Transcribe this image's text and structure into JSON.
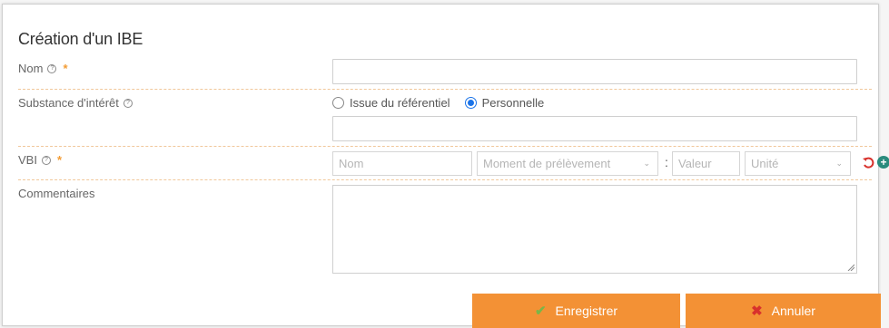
{
  "dialog": {
    "title": "Création d'un IBE"
  },
  "fields": {
    "nom": {
      "label": "Nom",
      "required_mark": "*",
      "value": ""
    },
    "substance": {
      "label": "Substance d'intérêt",
      "options": [
        "Issue du référentiel",
        "Personnelle"
      ],
      "selected": "Personnelle",
      "value": ""
    },
    "vbi": {
      "label": "VBI",
      "required_mark": "*",
      "nom_placeholder": "Nom",
      "moment_placeholder": "Moment de prélèvement",
      "colon": ":",
      "valeur_placeholder": "Valeur",
      "unite_placeholder": "Unité"
    },
    "commentaires": {
      "label": "Commentaires",
      "value": ""
    }
  },
  "icons": {
    "help": "?",
    "chevron": "⌄",
    "add": "+",
    "check": "✔",
    "close": "✖"
  },
  "buttons": {
    "save_label": "Enregistrer",
    "cancel_label": "Annuler"
  },
  "colors": {
    "accent": "#f39135",
    "required": "#f39c34",
    "radio_selected": "#1a73e8",
    "undo": "#d8312c",
    "add": "#2a8b7d"
  }
}
